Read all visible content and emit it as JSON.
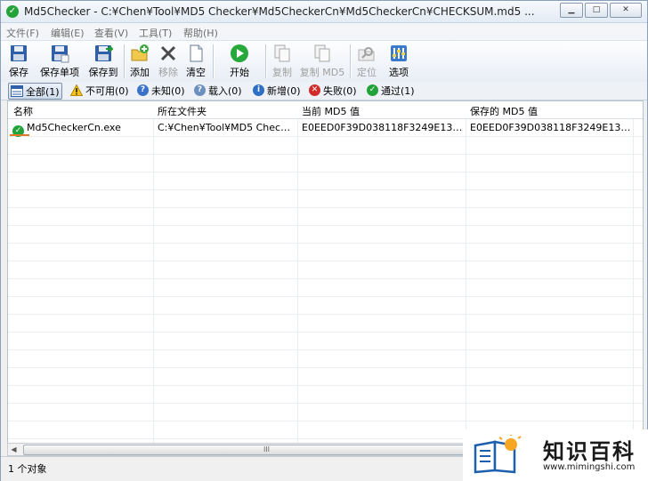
{
  "window": {
    "title": "Md5Checker - C:¥Chen¥Tool¥MD5 Checker¥Md5CheckerCn¥Md5CheckerCn¥CHECKSUM.md5 ...",
    "controls": [
      "minimize-icon",
      "maximize-icon",
      "close-icon"
    ]
  },
  "menu": {
    "file": "文件(F)",
    "edit": "编辑(E)",
    "view": "查看(V)",
    "tools": "工具(T)",
    "help": "帮助(H)"
  },
  "toolbar": {
    "save": "保存",
    "save_single": "保存单项",
    "save_to": "保存到",
    "add": "添加",
    "remove": "移除",
    "clear": "清空",
    "start": "开始",
    "copy": "复制",
    "copy_md5": "复制 MD5",
    "locate": "定位",
    "options": "选项"
  },
  "filters": {
    "all": "全部(1)",
    "unavailable": "不可用(0)",
    "unknown": "未知(0)",
    "loaded": "载入(0)",
    "new": "新增(0)",
    "failed": "失败(0)",
    "passed": "通过(1)"
  },
  "table": {
    "headers": [
      "名称",
      "所在文件夹",
      "当前 MD5 值",
      "保存的 MD5 值"
    ],
    "rows": [
      {
        "name": "Md5CheckerCn.exe",
        "folder": "C:¥Chen¥Tool¥MD5 Check...",
        "current_md5": "E0EED0F39D038118F3249E13E5...",
        "saved_md5": "E0EED0F39D038118F3249E13E5...",
        "status_icon": "check-circle-icon"
      }
    ]
  },
  "scrollbar": {
    "thumb_grip": "III"
  },
  "status": {
    "text": "1 个对象"
  },
  "watermark": {
    "title": "知识百科",
    "url": "www.mimingshi.com"
  },
  "colors": {
    "accent_green": "#22a33a",
    "title_bar": "#e3ebf4"
  }
}
